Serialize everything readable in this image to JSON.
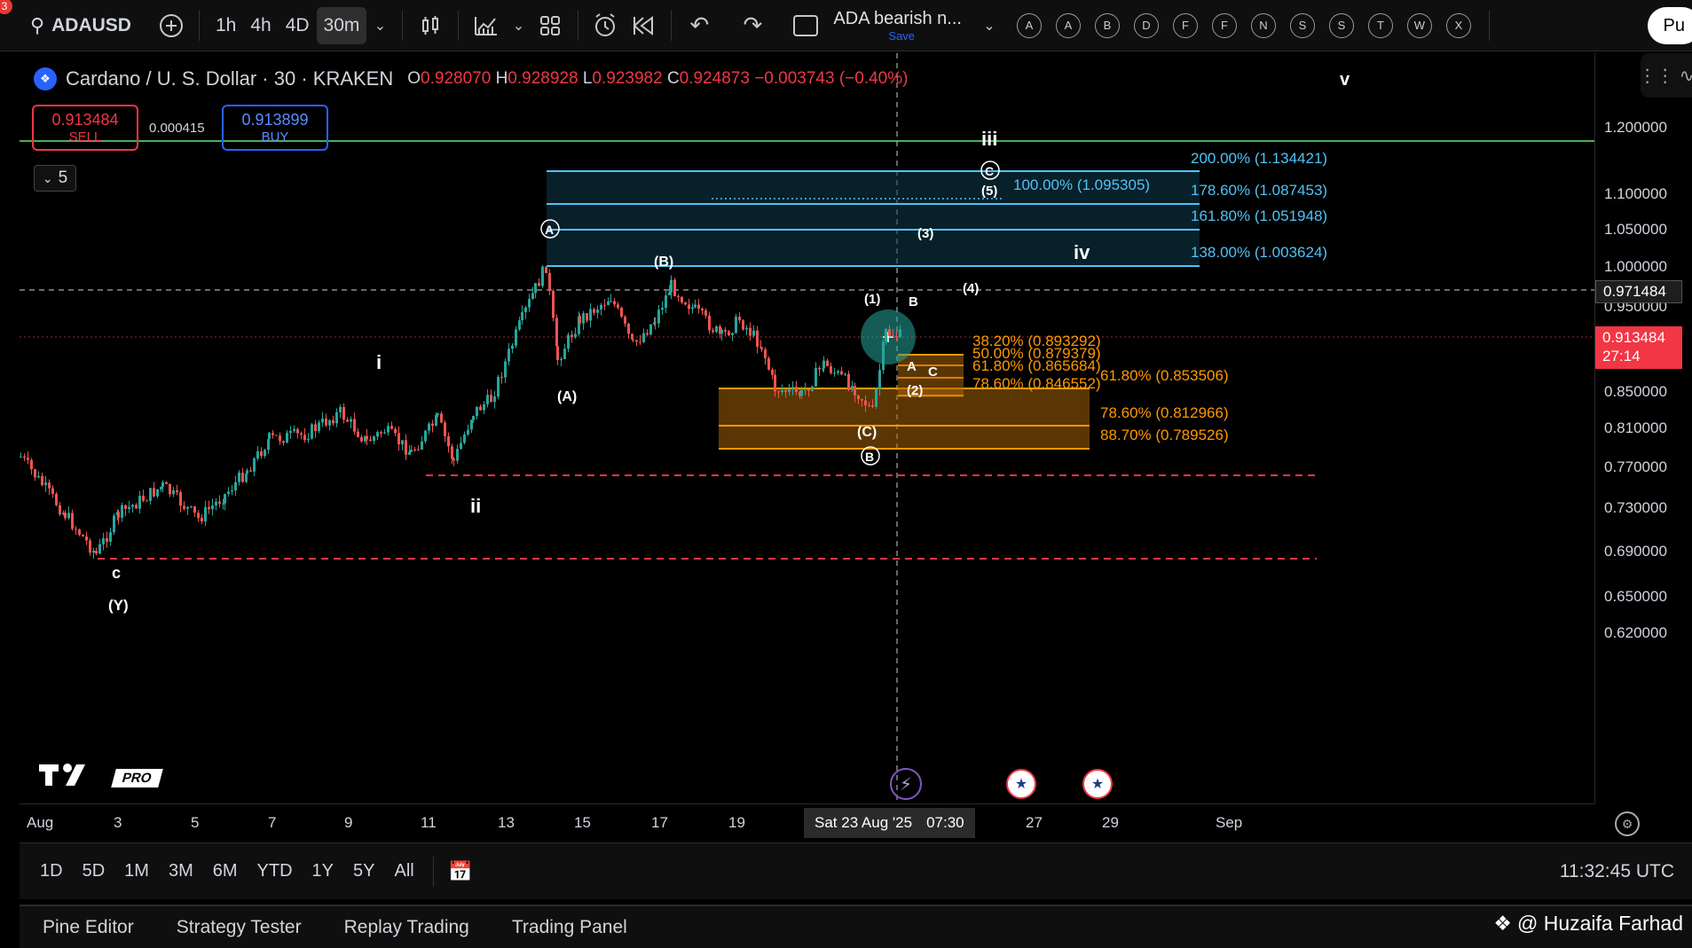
{
  "toolbar": {
    "notify_count": "3",
    "symbol": "ADAUSD",
    "timeframes": [
      "1h",
      "4h",
      "4D",
      "30m"
    ],
    "active_timeframe": "30m",
    "layout_name": "ADA bearish n...",
    "save_label": "Save",
    "drawing_letters": [
      "A",
      "A",
      "B",
      "D",
      "F",
      "F",
      "N",
      "S",
      "S",
      "T",
      "W",
      "X"
    ],
    "publish_label": "Pu"
  },
  "legend": {
    "title": "Cardano / U. S. Dollar · 30 · KRAKEN",
    "o_label": "O",
    "o_value": "0.928070",
    "h_label": "H",
    "h_value": "0.928928",
    "l_label": "L",
    "l_value": "0.923982",
    "c_label": "C",
    "c_value": "0.924873",
    "change": "−0.003743 (−0.40%)"
  },
  "trade": {
    "sell_price": "0.913484",
    "sell_label": "SELL",
    "spread": "0.000415",
    "buy_price": "0.913899",
    "buy_label": "BUY"
  },
  "collapse_label": "5",
  "tv_pro": "PRO",
  "price_axis": {
    "ticks": [
      "1.200000",
      "1.100000",
      "1.050000",
      "1.000000",
      "0.950000",
      "0.850000",
      "0.810000",
      "0.770000",
      "0.730000",
      "0.690000",
      "0.650000",
      "0.620000"
    ],
    "crosshair_price": "0.971484",
    "last_price": "0.913484",
    "countdown": "27:14"
  },
  "time_axis": {
    "ticks": [
      "Aug",
      "3",
      "5",
      "7",
      "9",
      "11",
      "13",
      "15",
      "17",
      "19",
      "27",
      "29",
      "Sep"
    ],
    "crosshair_date": "Sat 23 Aug '25",
    "crosshair_time": "07:30"
  },
  "fib_upper": [
    {
      "label": "200.00% (1.134421)"
    },
    {
      "label": "178.60% (1.087453)"
    },
    {
      "label": "161.80% (1.051948)"
    },
    {
      "label": "138.00% (1.003624)"
    },
    {
      "label": "100.00% (1.095305)"
    }
  ],
  "fib_lower": [
    {
      "label": "38.20% (0.893292)"
    },
    {
      "label": "50.00% (0.879379)"
    },
    {
      "label": "61.80% (0.865684)"
    },
    {
      "label": "78.60% (0.846552)"
    },
    {
      "label": "61.80% (0.853506)"
    },
    {
      "label": "78.60% (0.812966)"
    },
    {
      "label": "88.70% (0.789526)"
    }
  ],
  "waves": {
    "i": "i",
    "ii": "ii",
    "iii": "iii",
    "iv": "iv",
    "v": "v",
    "c_low": "c",
    "y_low": "(Y)",
    "A_paren": "(A)",
    "B_paren": "(B)",
    "C_paren": "(C)",
    "A_circle": "A",
    "B_circle": "B",
    "C_circle": "C",
    "w1": "(1)",
    "w2": "(2)",
    "w3": "(3)",
    "w4": "(4)",
    "w5": "(5)",
    "sub_A": "A",
    "sub_B": "B",
    "sub_C": "C"
  },
  "range_bar": {
    "ranges": [
      "1D",
      "5D",
      "1M",
      "3M",
      "6M",
      "YTD",
      "1Y",
      "5Y",
      "All"
    ],
    "clock": "11:32:45 UTC"
  },
  "bottom_tabs": [
    "Pine Editor",
    "Strategy Tester",
    "Replay Trading",
    "Trading Panel"
  ],
  "watermark": "@ Huzaifa Farhad",
  "colors": {
    "up": "#26a69a",
    "down": "#ef5350",
    "fib_blue": "#4fc3f7",
    "fib_orange": "#ff9800",
    "green_line": "#4caf50",
    "red_dashed": "#f23645"
  }
}
